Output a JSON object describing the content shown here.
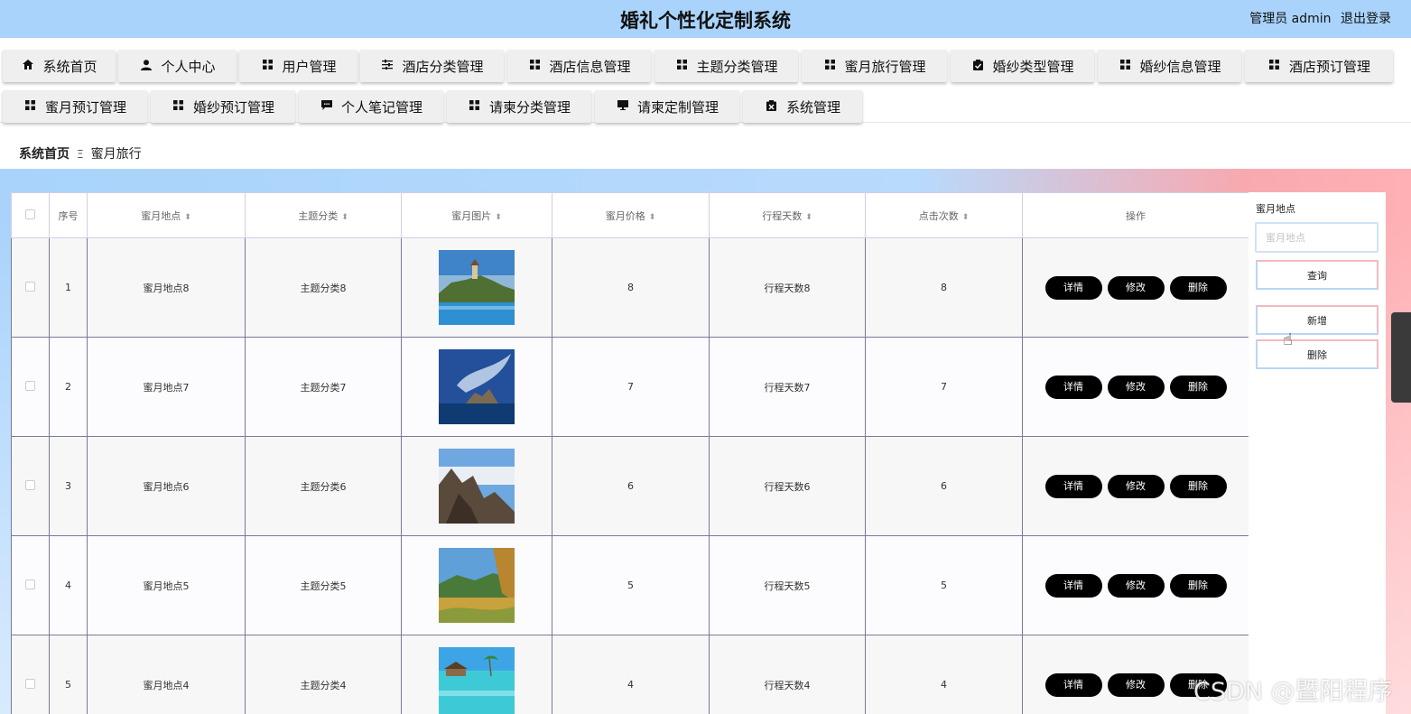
{
  "header": {
    "title": "婚礼个性化定制系统",
    "user_label": "管理员 admin",
    "logout_label": "退出登录",
    "bg_color": "#a9d3fb"
  },
  "nav": {
    "items": [
      {
        "icon": "home-icon",
        "label": "系统首页"
      },
      {
        "icon": "user-icon",
        "label": "个人中心"
      },
      {
        "icon": "grid-icon",
        "label": "用户管理"
      },
      {
        "icon": "sliders-icon",
        "label": "酒店分类管理"
      },
      {
        "icon": "grid-icon",
        "label": "酒店信息管理"
      },
      {
        "icon": "grid-icon",
        "label": "主题分类管理"
      },
      {
        "icon": "grid-icon",
        "label": "蜜月旅行管理"
      },
      {
        "icon": "clipboard-icon",
        "label": "婚纱类型管理"
      },
      {
        "icon": "grid-icon",
        "label": "婚纱信息管理"
      },
      {
        "icon": "grid-icon",
        "label": "酒店预订管理"
      },
      {
        "icon": "grid-icon",
        "label": "蜜月预订管理"
      },
      {
        "icon": "grid-icon",
        "label": "婚纱预订管理"
      },
      {
        "icon": "chat-icon",
        "label": "个人笔记管理"
      },
      {
        "icon": "grid-icon",
        "label": "请柬分类管理"
      },
      {
        "icon": "monitor-icon",
        "label": "请柬定制管理"
      },
      {
        "icon": "delete-box-icon",
        "label": "系统管理"
      }
    ]
  },
  "breadcrumb": {
    "home": "系统首页",
    "separator": "Ξ",
    "current": "蜜月旅行"
  },
  "table": {
    "columns": [
      "序号",
      "蜜月地点",
      "主题分类",
      "蜜月图片",
      "蜜月价格",
      "行程天数",
      "点击次数",
      "操作"
    ],
    "actions": [
      "详情",
      "修改",
      "删除"
    ],
    "rows": [
      {
        "index": "1",
        "place": "蜜月地点8",
        "theme": "主题分类8",
        "image": "lake-hill-photo",
        "price": "8",
        "days": "行程天数8",
        "clicks": "8"
      },
      {
        "index": "2",
        "place": "蜜月地点7",
        "theme": "主题分类7",
        "image": "sea-rock-photo",
        "price": "7",
        "days": "行程天数7",
        "clicks": "7"
      },
      {
        "index": "3",
        "place": "蜜月地点6",
        "theme": "主题分类6",
        "image": "mountain-photo",
        "price": "6",
        "days": "行程天数6",
        "clicks": "6"
      },
      {
        "index": "4",
        "place": "蜜月地点5",
        "theme": "主题分类5",
        "image": "valley-photo",
        "price": "5",
        "days": "行程天数5",
        "clicks": "5"
      },
      {
        "index": "5",
        "place": "蜜月地点4",
        "theme": "主题分类4",
        "image": "beach-photo",
        "price": "4",
        "days": "行程天数4",
        "clicks": "4"
      }
    ]
  },
  "search": {
    "label": "蜜月地点",
    "placeholder": "蜜月地点",
    "query_label": "查询",
    "add_label": "新增",
    "delete_label": "删除"
  },
  "watermark": "CSDN @暨阳程序"
}
